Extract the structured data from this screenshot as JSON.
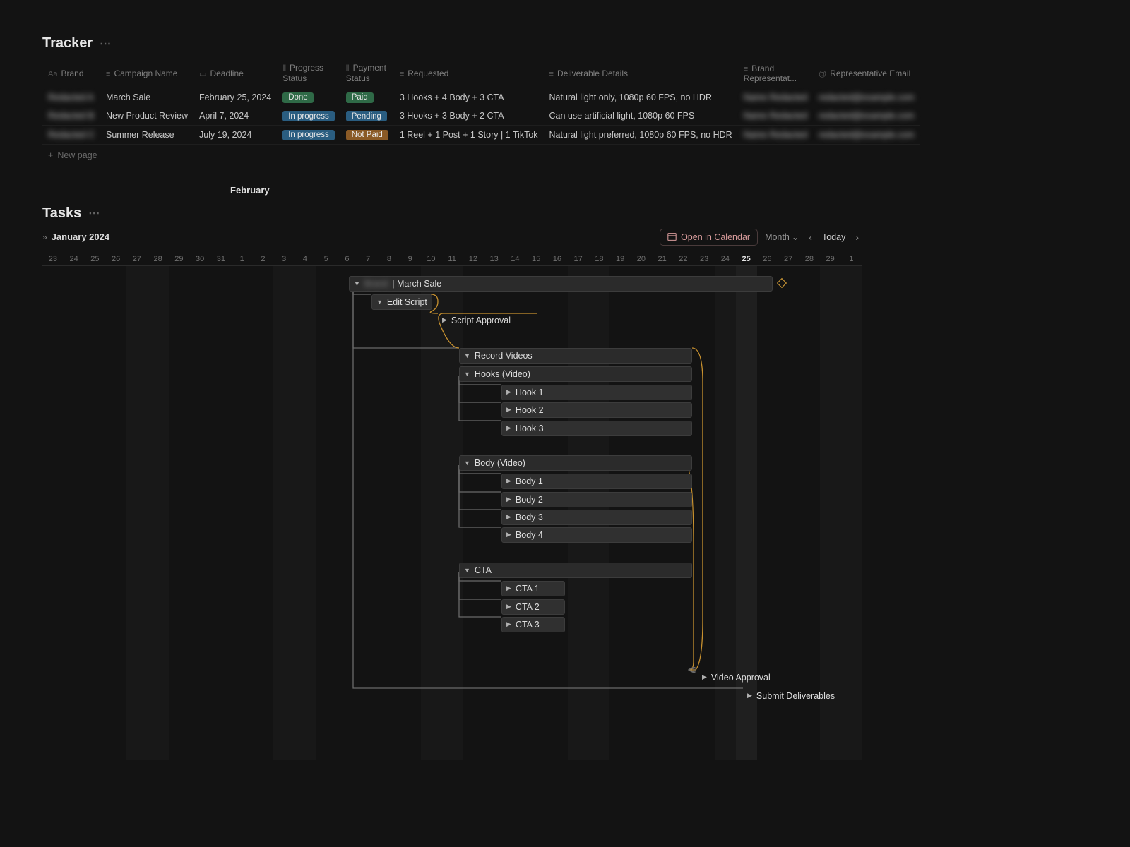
{
  "tracker": {
    "title": "Tracker",
    "columns": {
      "brand": "Brand",
      "campaign": "Campaign Name",
      "deadline": "Deadline",
      "progress": "Progress Status",
      "payment": "Payment Status",
      "requested": "Requested",
      "deliverable": "Deliverable Details",
      "rep": "Brand Representat...",
      "email": "Representative Email"
    },
    "rows": [
      {
        "brand": "Redacted A",
        "campaign": "March Sale",
        "deadline": "February 25, 2024",
        "progress": "Done",
        "payment": "Paid",
        "requested": "3 Hooks + 4 Body + 3 CTA",
        "deliverable": "Natural light only, 1080p 60 FPS, no HDR",
        "rep": "Name Redacted",
        "email": "redacted@example.com"
      },
      {
        "brand": "Redacted B",
        "campaign": "New Product Review",
        "deadline": "April 7, 2024",
        "progress": "In progress",
        "payment": "Pending",
        "requested": "3 Hooks + 3 Body + 2 CTA",
        "deliverable": "Can use artificial light, 1080p 60 FPS",
        "rep": "Name Redacted",
        "email": "redacted@example.com"
      },
      {
        "brand": "Redacted C",
        "campaign": "Summer Release",
        "deadline": "July 19, 2024",
        "progress": "In progress",
        "payment": "Not Paid",
        "requested": "1 Reel + 1 Post + 1 Story | 1 TikTok",
        "deliverable": "Natural light preferred, 1080p 60 FPS, no HDR",
        "rep": "Name Redacted",
        "email": "redacted@example.com"
      }
    ],
    "newpage": "New page"
  },
  "tasks": {
    "title": "Tasks",
    "month1": "January 2024",
    "month2": "February",
    "open_calendar": "Open in Calendar",
    "view": "Month",
    "today": "Today",
    "days": [
      "23",
      "24",
      "25",
      "26",
      "27",
      "28",
      "29",
      "30",
      "31",
      "1",
      "2",
      "3",
      "4",
      "5",
      "6",
      "7",
      "8",
      "9",
      "10",
      "11",
      "12",
      "13",
      "14",
      "15",
      "16",
      "17",
      "18",
      "19",
      "20",
      "21",
      "22",
      "23",
      "24",
      "25",
      "26",
      "27",
      "28",
      "29",
      "1"
    ],
    "highlight_day": "25",
    "bars": {
      "parent": "| March Sale",
      "parent_blur_prefix": "Brand",
      "edit_script": "Edit Script",
      "script_approval": "Script Approval",
      "record_videos": "Record Videos",
      "hooks": "Hooks (Video)",
      "hook1": "Hook 1",
      "hook2": "Hook 2",
      "hook3": "Hook 3",
      "body": "Body (Video)",
      "body1": "Body 1",
      "body2": "Body 2",
      "body3": "Body 3",
      "body4": "Body 4",
      "cta": "CTA",
      "cta1": "CTA 1",
      "cta2": "CTA 2",
      "cta3": "CTA 3",
      "video_approval": "Video Approval",
      "submit": "Submit Deliverables"
    }
  }
}
